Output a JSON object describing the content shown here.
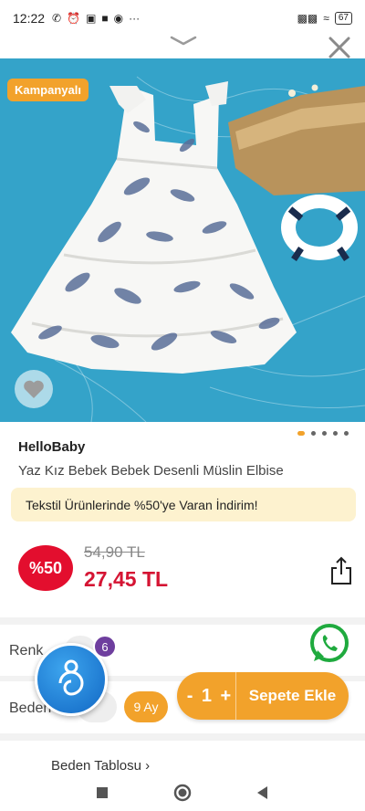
{
  "status_bar": {
    "time": "12:22",
    "battery": "67",
    "more": "···"
  },
  "hero": {
    "badge": "Kampanyalı"
  },
  "product": {
    "brand": "HelloBaby",
    "name": "Yaz Kız Bebek Bebek Desenli Müslin Elbise",
    "promo": "Tekstil Ürünlerinde %50'ye Varan İndirim!",
    "discount": "%50",
    "old_price": "54,90 TL",
    "new_price": "27,45 TL"
  },
  "options": {
    "color_label": "Renk",
    "size_label": "Beden",
    "selected_size": "9 Ay"
  },
  "size_table_label": "Beden Tablosu",
  "app_icon": {
    "badge": "6"
  },
  "cart": {
    "minus": "-",
    "quantity": "1",
    "plus": "+",
    "label": "Sepete Ekle"
  },
  "colors": {
    "accent": "#f2a22b",
    "price": "#d51433",
    "discount": "#e30e2e",
    "hero_bg": "#34a3c9"
  }
}
